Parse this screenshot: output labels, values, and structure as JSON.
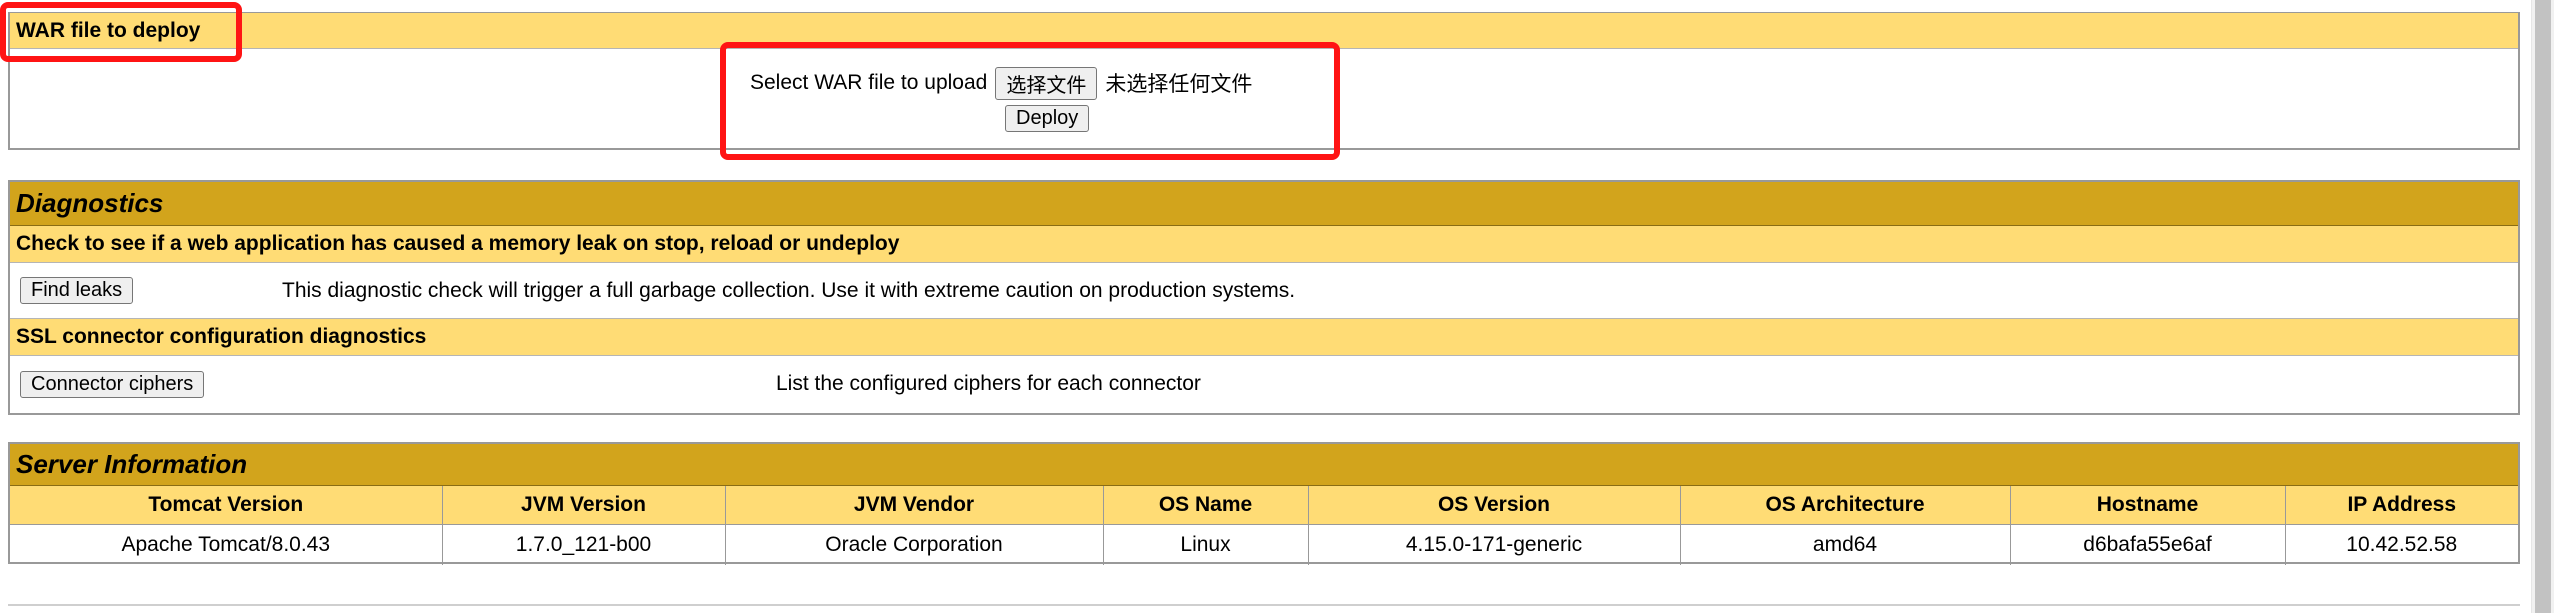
{
  "deploy": {
    "header": "WAR file to deploy",
    "upload_label": "Select WAR file to upload",
    "choose_button": "选择文件",
    "no_file_text": "未选择任何文件",
    "deploy_button": "Deploy"
  },
  "diagnostics": {
    "title": "Diagnostics",
    "leak_header": "Check to see if a web application has caused a memory leak on stop, reload or undeploy",
    "find_leaks_button": "Find leaks",
    "leak_desc": "This diagnostic check will trigger a full garbage collection. Use it with extreme caution on production systems.",
    "ssl_header": "SSL connector configuration diagnostics",
    "ciphers_button": "Connector ciphers",
    "ciphers_desc": "List the configured ciphers for each connector"
  },
  "server_info": {
    "title": "Server Information",
    "headers": [
      "Tomcat Version",
      "JVM Version",
      "JVM Vendor",
      "OS Name",
      "OS Version",
      "OS Architecture",
      "Hostname",
      "IP Address"
    ],
    "values": [
      "Apache Tomcat/8.0.43",
      "1.7.0_121-b00",
      "Oracle Corporation",
      "Linux",
      "4.15.0-171-generic",
      "amd64",
      "d6bafa55e6af",
      "10.42.52.58"
    ]
  },
  "colors": {
    "header_light": "#ffdc75",
    "header_dark": "#d2a41c",
    "annotation": "#ff1414"
  }
}
